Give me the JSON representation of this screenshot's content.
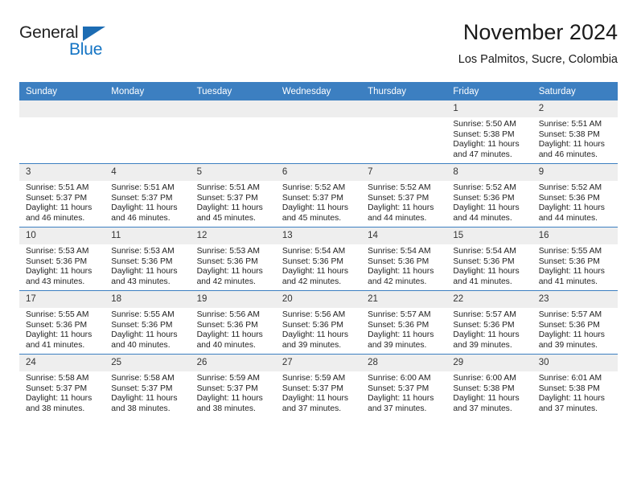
{
  "brand": {
    "name_part1": "General",
    "name_part2": "Blue",
    "accent_color": "#1474c4",
    "triangle_color": "#1c6cb3"
  },
  "header": {
    "title": "November 2024",
    "subtitle": "Los Palmitos, Sucre, Colombia"
  },
  "theme": {
    "header_row_bg": "#3c7fc1",
    "daynum_bg": "#eeeeee",
    "grid_line": "#3c7fc1"
  },
  "weekday_headers": [
    "Sunday",
    "Monday",
    "Tuesday",
    "Wednesday",
    "Thursday",
    "Friday",
    "Saturday"
  ],
  "weeks": [
    [
      {
        "day": "",
        "sunrise": "",
        "sunset": "",
        "daylight_line1": "",
        "daylight_line2": ""
      },
      {
        "day": "",
        "sunrise": "",
        "sunset": "",
        "daylight_line1": "",
        "daylight_line2": ""
      },
      {
        "day": "",
        "sunrise": "",
        "sunset": "",
        "daylight_line1": "",
        "daylight_line2": ""
      },
      {
        "day": "",
        "sunrise": "",
        "sunset": "",
        "daylight_line1": "",
        "daylight_line2": ""
      },
      {
        "day": "",
        "sunrise": "",
        "sunset": "",
        "daylight_line1": "",
        "daylight_line2": ""
      },
      {
        "day": "1",
        "sunrise": "Sunrise: 5:50 AM",
        "sunset": "Sunset: 5:38 PM",
        "daylight_line1": "Daylight: 11 hours",
        "daylight_line2": "and 47 minutes."
      },
      {
        "day": "2",
        "sunrise": "Sunrise: 5:51 AM",
        "sunset": "Sunset: 5:38 PM",
        "daylight_line1": "Daylight: 11 hours",
        "daylight_line2": "and 46 minutes."
      }
    ],
    [
      {
        "day": "3",
        "sunrise": "Sunrise: 5:51 AM",
        "sunset": "Sunset: 5:37 PM",
        "daylight_line1": "Daylight: 11 hours",
        "daylight_line2": "and 46 minutes."
      },
      {
        "day": "4",
        "sunrise": "Sunrise: 5:51 AM",
        "sunset": "Sunset: 5:37 PM",
        "daylight_line1": "Daylight: 11 hours",
        "daylight_line2": "and 46 minutes."
      },
      {
        "day": "5",
        "sunrise": "Sunrise: 5:51 AM",
        "sunset": "Sunset: 5:37 PM",
        "daylight_line1": "Daylight: 11 hours",
        "daylight_line2": "and 45 minutes."
      },
      {
        "day": "6",
        "sunrise": "Sunrise: 5:52 AM",
        "sunset": "Sunset: 5:37 PM",
        "daylight_line1": "Daylight: 11 hours",
        "daylight_line2": "and 45 minutes."
      },
      {
        "day": "7",
        "sunrise": "Sunrise: 5:52 AM",
        "sunset": "Sunset: 5:37 PM",
        "daylight_line1": "Daylight: 11 hours",
        "daylight_line2": "and 44 minutes."
      },
      {
        "day": "8",
        "sunrise": "Sunrise: 5:52 AM",
        "sunset": "Sunset: 5:36 PM",
        "daylight_line1": "Daylight: 11 hours",
        "daylight_line2": "and 44 minutes."
      },
      {
        "day": "9",
        "sunrise": "Sunrise: 5:52 AM",
        "sunset": "Sunset: 5:36 PM",
        "daylight_line1": "Daylight: 11 hours",
        "daylight_line2": "and 44 minutes."
      }
    ],
    [
      {
        "day": "10",
        "sunrise": "Sunrise: 5:53 AM",
        "sunset": "Sunset: 5:36 PM",
        "daylight_line1": "Daylight: 11 hours",
        "daylight_line2": "and 43 minutes."
      },
      {
        "day": "11",
        "sunrise": "Sunrise: 5:53 AM",
        "sunset": "Sunset: 5:36 PM",
        "daylight_line1": "Daylight: 11 hours",
        "daylight_line2": "and 43 minutes."
      },
      {
        "day": "12",
        "sunrise": "Sunrise: 5:53 AM",
        "sunset": "Sunset: 5:36 PM",
        "daylight_line1": "Daylight: 11 hours",
        "daylight_line2": "and 42 minutes."
      },
      {
        "day": "13",
        "sunrise": "Sunrise: 5:54 AM",
        "sunset": "Sunset: 5:36 PM",
        "daylight_line1": "Daylight: 11 hours",
        "daylight_line2": "and 42 minutes."
      },
      {
        "day": "14",
        "sunrise": "Sunrise: 5:54 AM",
        "sunset": "Sunset: 5:36 PM",
        "daylight_line1": "Daylight: 11 hours",
        "daylight_line2": "and 42 minutes."
      },
      {
        "day": "15",
        "sunrise": "Sunrise: 5:54 AM",
        "sunset": "Sunset: 5:36 PM",
        "daylight_line1": "Daylight: 11 hours",
        "daylight_line2": "and 41 minutes."
      },
      {
        "day": "16",
        "sunrise": "Sunrise: 5:55 AM",
        "sunset": "Sunset: 5:36 PM",
        "daylight_line1": "Daylight: 11 hours",
        "daylight_line2": "and 41 minutes."
      }
    ],
    [
      {
        "day": "17",
        "sunrise": "Sunrise: 5:55 AM",
        "sunset": "Sunset: 5:36 PM",
        "daylight_line1": "Daylight: 11 hours",
        "daylight_line2": "and 41 minutes."
      },
      {
        "day": "18",
        "sunrise": "Sunrise: 5:55 AM",
        "sunset": "Sunset: 5:36 PM",
        "daylight_line1": "Daylight: 11 hours",
        "daylight_line2": "and 40 minutes."
      },
      {
        "day": "19",
        "sunrise": "Sunrise: 5:56 AM",
        "sunset": "Sunset: 5:36 PM",
        "daylight_line1": "Daylight: 11 hours",
        "daylight_line2": "and 40 minutes."
      },
      {
        "day": "20",
        "sunrise": "Sunrise: 5:56 AM",
        "sunset": "Sunset: 5:36 PM",
        "daylight_line1": "Daylight: 11 hours",
        "daylight_line2": "and 39 minutes."
      },
      {
        "day": "21",
        "sunrise": "Sunrise: 5:57 AM",
        "sunset": "Sunset: 5:36 PM",
        "daylight_line1": "Daylight: 11 hours",
        "daylight_line2": "and 39 minutes."
      },
      {
        "day": "22",
        "sunrise": "Sunrise: 5:57 AM",
        "sunset": "Sunset: 5:36 PM",
        "daylight_line1": "Daylight: 11 hours",
        "daylight_line2": "and 39 minutes."
      },
      {
        "day": "23",
        "sunrise": "Sunrise: 5:57 AM",
        "sunset": "Sunset: 5:36 PM",
        "daylight_line1": "Daylight: 11 hours",
        "daylight_line2": "and 39 minutes."
      }
    ],
    [
      {
        "day": "24",
        "sunrise": "Sunrise: 5:58 AM",
        "sunset": "Sunset: 5:37 PM",
        "daylight_line1": "Daylight: 11 hours",
        "daylight_line2": "and 38 minutes."
      },
      {
        "day": "25",
        "sunrise": "Sunrise: 5:58 AM",
        "sunset": "Sunset: 5:37 PM",
        "daylight_line1": "Daylight: 11 hours",
        "daylight_line2": "and 38 minutes."
      },
      {
        "day": "26",
        "sunrise": "Sunrise: 5:59 AM",
        "sunset": "Sunset: 5:37 PM",
        "daylight_line1": "Daylight: 11 hours",
        "daylight_line2": "and 38 minutes."
      },
      {
        "day": "27",
        "sunrise": "Sunrise: 5:59 AM",
        "sunset": "Sunset: 5:37 PM",
        "daylight_line1": "Daylight: 11 hours",
        "daylight_line2": "and 37 minutes."
      },
      {
        "day": "28",
        "sunrise": "Sunrise: 6:00 AM",
        "sunset": "Sunset: 5:37 PM",
        "daylight_line1": "Daylight: 11 hours",
        "daylight_line2": "and 37 minutes."
      },
      {
        "day": "29",
        "sunrise": "Sunrise: 6:00 AM",
        "sunset": "Sunset: 5:38 PM",
        "daylight_line1": "Daylight: 11 hours",
        "daylight_line2": "and 37 minutes."
      },
      {
        "day": "30",
        "sunrise": "Sunrise: 6:01 AM",
        "sunset": "Sunset: 5:38 PM",
        "daylight_line1": "Daylight: 11 hours",
        "daylight_line2": "and 37 minutes."
      }
    ]
  ]
}
